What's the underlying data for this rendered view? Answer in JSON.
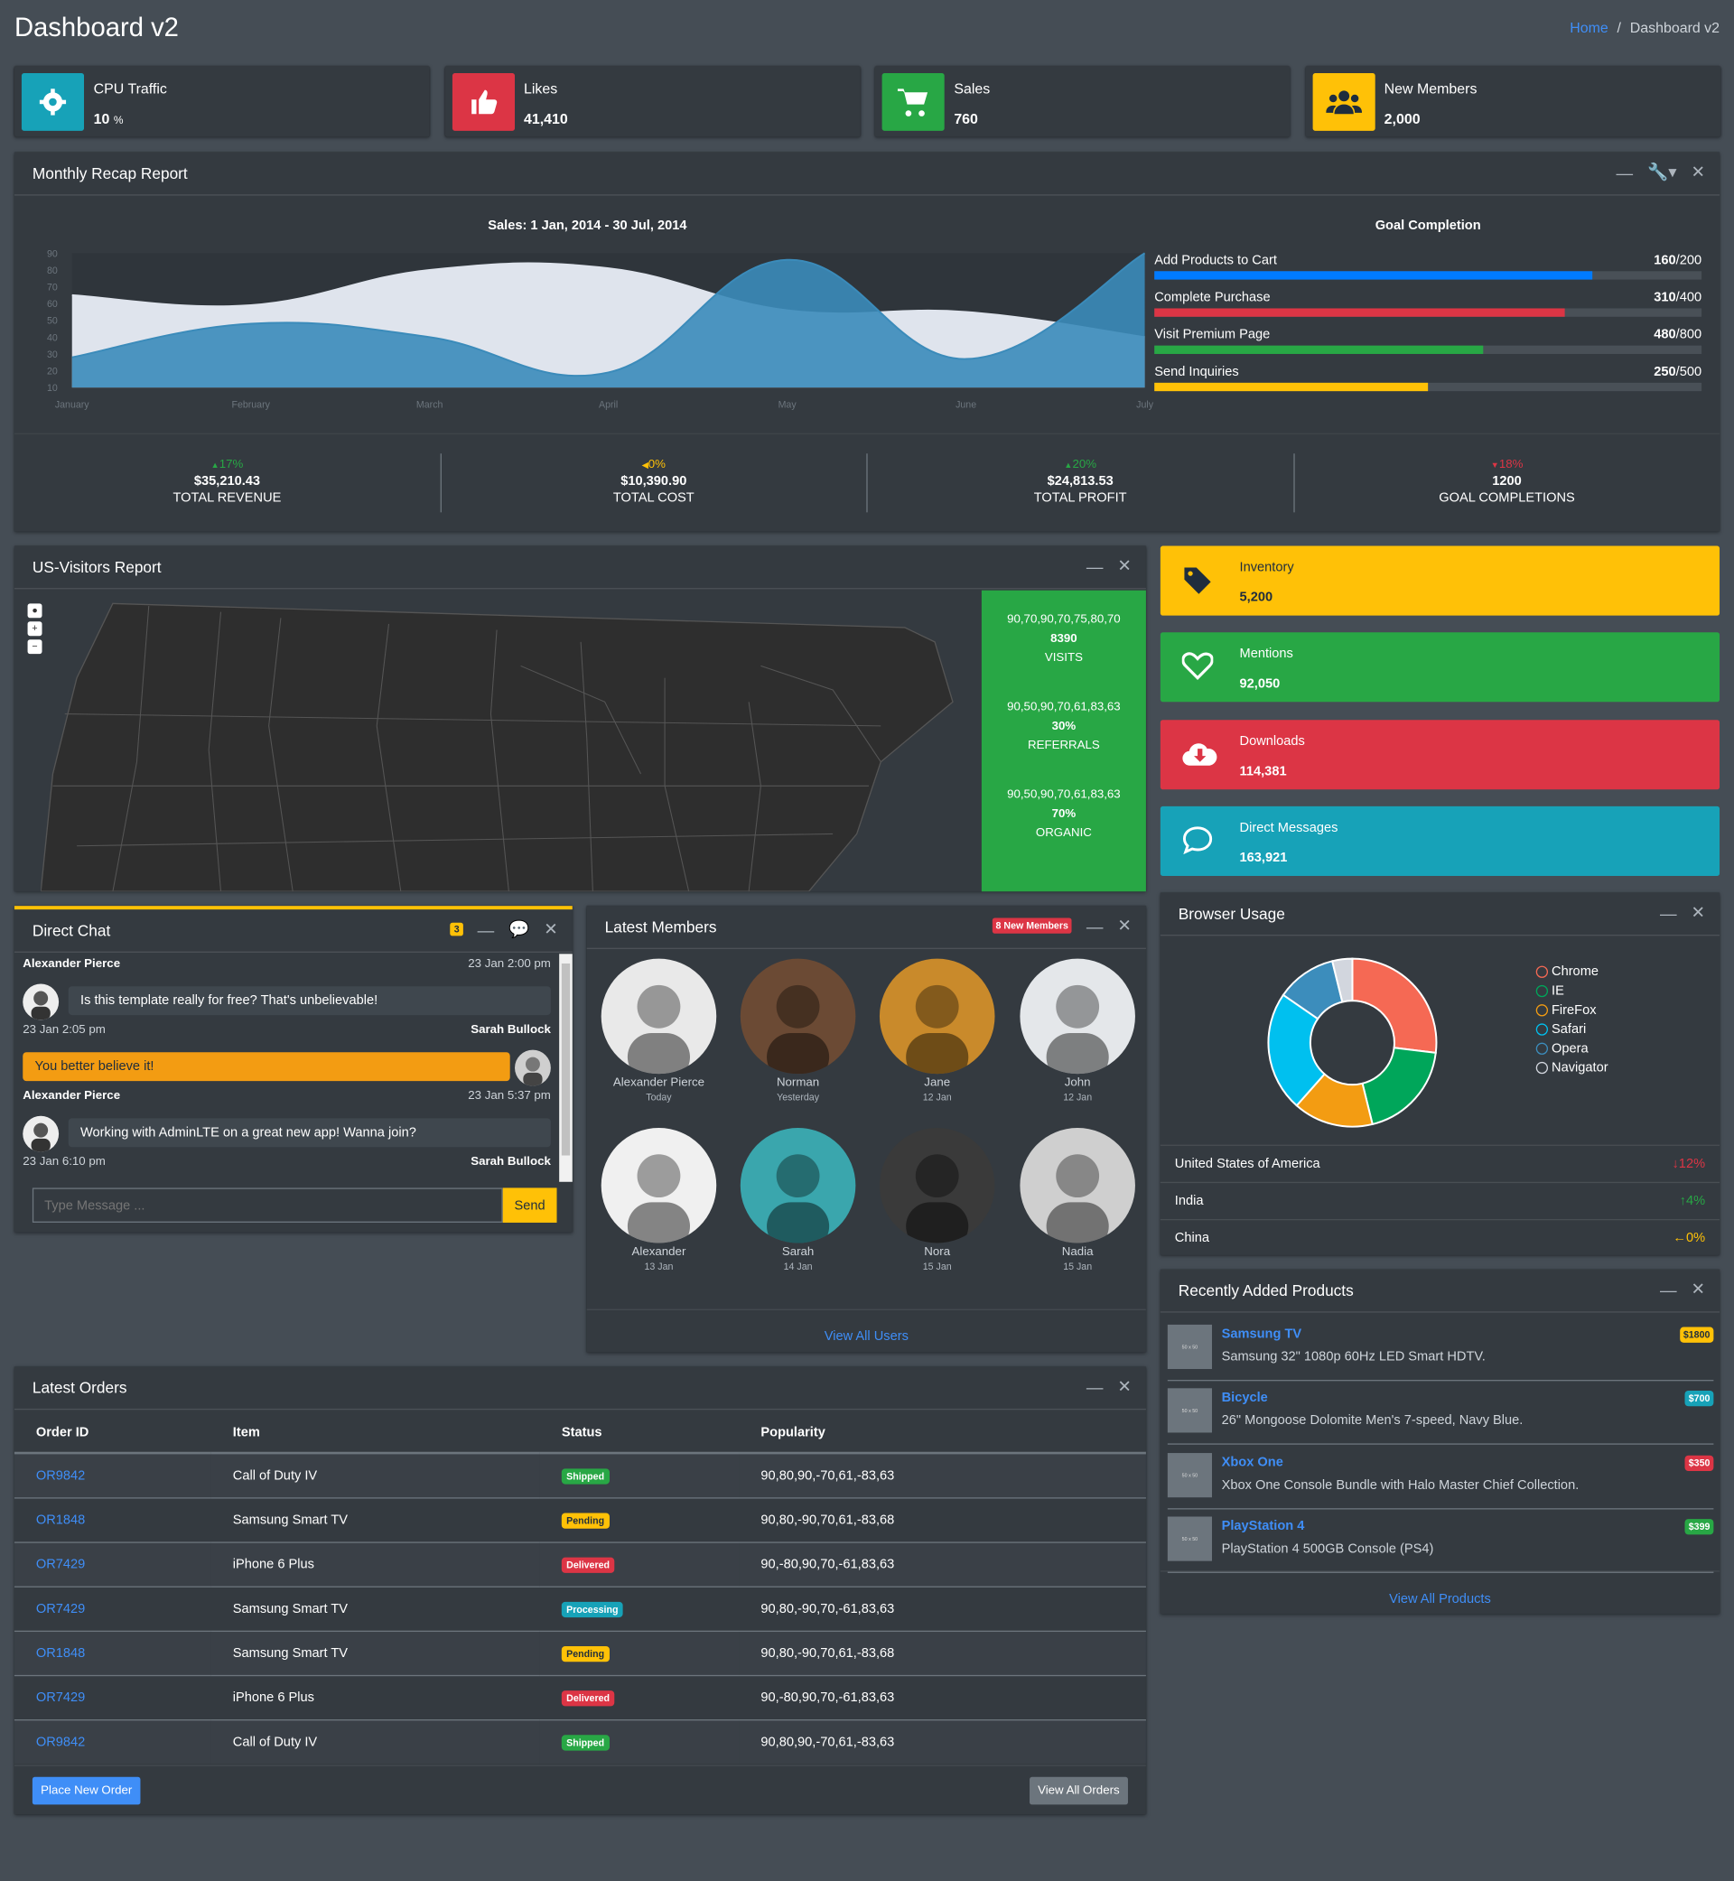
{
  "header": {
    "title": "Dashboard v2",
    "breadcrumb_home": "Home",
    "breadcrumb_sep": "/",
    "breadcrumb_current": "Dashboard v2"
  },
  "info_boxes": [
    {
      "label": "CPU Traffic",
      "value": "10",
      "unit": "%",
      "color": "#17a2b8",
      "icon": "gear-icon"
    },
    {
      "label": "Likes",
      "value": "41,410",
      "color": "#dc3545",
      "icon": "thumbs-up-icon"
    },
    {
      "label": "Sales",
      "value": "760",
      "color": "#28a745",
      "icon": "cart-icon"
    },
    {
      "label": "New Members",
      "value": "2,000",
      "color": "#ffc107",
      "icon": "users-icon"
    }
  ],
  "recap": {
    "title": "Monthly Recap Report",
    "chart_title": "Sales: 1 Jan, 2014 - 30 Jul, 2014",
    "goal_title": "Goal Completion",
    "goals": [
      {
        "label": "Add Products to Cart",
        "value": "160",
        "total": "/200",
        "fraction": 0.8,
        "color": "#007bff"
      },
      {
        "label": "Complete Purchase",
        "value": "310",
        "total": "/400",
        "fraction": 0.75,
        "color": "#dc3545"
      },
      {
        "label": "Visit Premium Page",
        "value": "480",
        "total": "/800",
        "fraction": 0.6,
        "color": "#28a745"
      },
      {
        "label": "Send Inquiries",
        "value": "250",
        "total": "/500",
        "fraction": 0.5,
        "color": "#ffc107"
      }
    ],
    "footer": [
      {
        "pct": "17%",
        "dir": "up",
        "color": "#28a745",
        "arrow": "▲",
        "amount": "$35,210.43",
        "label": "TOTAL REVENUE"
      },
      {
        "pct": "0%",
        "dir": "left",
        "color": "#ffc107",
        "arrow": "◀",
        "amount": "$10,390.90",
        "label": "TOTAL COST"
      },
      {
        "pct": "20%",
        "dir": "up",
        "color": "#28a745",
        "arrow": "▲",
        "amount": "$24,813.53",
        "label": "TOTAL PROFIT"
      },
      {
        "pct": "18%",
        "dir": "down",
        "color": "#dc3545",
        "arrow": "▼",
        "amount": "1200",
        "label": "GOAL COMPLETIONS"
      }
    ]
  },
  "chart_data": {
    "type": "area",
    "categories": [
      "January",
      "February",
      "March",
      "April",
      "May",
      "June",
      "July"
    ],
    "ylim": [
      10,
      90
    ],
    "yticks": [
      10,
      20,
      30,
      40,
      50,
      60,
      70,
      80,
      90
    ],
    "series": [
      {
        "values": [
          65,
          59,
          80,
          81,
          56,
          55,
          40
        ],
        "color": "#dfe4ed"
      },
      {
        "values": [
          28,
          48,
          40,
          19,
          86,
          27,
          90
        ],
        "color": "#3b8bba"
      }
    ]
  },
  "visitors": {
    "title": "US-Visitors Report",
    "stats": [
      {
        "spark": "90,70,90,70,75,80,70",
        "value": "8390",
        "label": "VISITS"
      },
      {
        "spark": "90,50,90,70,61,83,63",
        "value": "30%",
        "label": "REFERRALS"
      },
      {
        "spark": "90,50,90,70,61,83,63",
        "value": "70%",
        "label": "ORGANIC"
      }
    ]
  },
  "small_boxes": [
    {
      "label": "Inventory",
      "value": "5,200",
      "color": "#ffc107",
      "text": "#1f2d3d",
      "icon": "tag-icon"
    },
    {
      "label": "Mentions",
      "value": "92,050",
      "color": "#28a745",
      "text": "#fff",
      "icon": "heart-icon"
    },
    {
      "label": "Downloads",
      "value": "114,381",
      "color": "#dc3545",
      "text": "#fff",
      "icon": "cloud-download-icon"
    },
    {
      "label": "Direct Messages",
      "value": "163,921",
      "color": "#17a2b8",
      "text": "#fff",
      "icon": "comment-icon"
    }
  ],
  "chat": {
    "title": "Direct Chat",
    "badge": "3",
    "messages": [
      {
        "name": "Alexander Pierce",
        "time": "23 Jan 2:00 pm",
        "text": "Is this template really for free? That's unbelievable!",
        "side": "left"
      },
      {
        "name": "Sarah Bullock",
        "time": "23 Jan 2:05 pm",
        "text": "You better believe it!",
        "side": "right"
      },
      {
        "name": "Alexander Pierce",
        "time": "23 Jan 5:37 pm",
        "text": "Working with AdminLTE on a great new app! Wanna join?",
        "side": "left"
      },
      {
        "name": "Sarah Bullock",
        "time": "23 Jan 6:10 pm",
        "text": "",
        "side": "right"
      }
    ],
    "placeholder": "Type Message ...",
    "send": "Send"
  },
  "members": {
    "title": "Latest Members",
    "badge": "8 New Members",
    "view_all": "View All Users",
    "list": [
      {
        "name": "Alexander Pierce",
        "date": "Today",
        "color": "#e9e9e9"
      },
      {
        "name": "Norman",
        "date": "Yesterday",
        "color": "#6b4a34"
      },
      {
        "name": "Jane",
        "date": "12 Jan",
        "color": "#c98a2b"
      },
      {
        "name": "John",
        "date": "12 Jan",
        "color": "#e4e7ea"
      },
      {
        "name": "Alexander",
        "date": "13 Jan",
        "color": "#f0f0f0"
      },
      {
        "name": "Sarah",
        "date": "14 Jan",
        "color": "#3aa6ad"
      },
      {
        "name": "Nora",
        "date": "15 Jan",
        "color": "#3a3a3a"
      },
      {
        "name": "Nadia",
        "date": "15 Jan",
        "color": "#cfcfcf"
      }
    ]
  },
  "browser": {
    "title": "Browser Usage",
    "legend": [
      {
        "name": "Chrome",
        "color": "#f56954",
        "value": 700
      },
      {
        "name": "IE",
        "color": "#00a65a",
        "value": 500
      },
      {
        "name": "FireFox",
        "color": "#f39c12",
        "value": 400
      },
      {
        "name": "Safari",
        "color": "#00c0ef",
        "value": 600
      },
      {
        "name": "Opera",
        "color": "#3c8dbc",
        "value": 300
      },
      {
        "name": "Navigator",
        "color": "#d2d6de",
        "value": 100
      }
    ],
    "countries": [
      {
        "name": "United States of America",
        "value": "12%",
        "arrow": "↓",
        "color": "#dc3545"
      },
      {
        "name": "India",
        "value": "4%",
        "arrow": "↑",
        "color": "#28a745"
      },
      {
        "name": "China",
        "value": "0%",
        "arrow": "←",
        "color": "#ffc107"
      }
    ]
  },
  "orders": {
    "title": "Latest Orders",
    "headers": [
      "Order ID",
      "Item",
      "Status",
      "Popularity"
    ],
    "rows": [
      {
        "id": "OR9842",
        "item": "Call of Duty IV",
        "status": "Shipped",
        "color": "#28a745",
        "pop": "90,80,90,-70,61,-83,63"
      },
      {
        "id": "OR1848",
        "item": "Samsung Smart TV",
        "status": "Pending",
        "color": "#ffc107",
        "pop": "90,80,-90,70,61,-83,68"
      },
      {
        "id": "OR7429",
        "item": "iPhone 6 Plus",
        "status": "Delivered",
        "color": "#dc3545",
        "pop": "90,-80,90,70,-61,83,63"
      },
      {
        "id": "OR7429",
        "item": "Samsung Smart TV",
        "status": "Processing",
        "color": "#17a2b8",
        "pop": "90,80,-90,70,-61,83,63"
      },
      {
        "id": "OR1848",
        "item": "Samsung Smart TV",
        "status": "Pending",
        "color": "#ffc107",
        "pop": "90,80,-90,70,61,-83,68"
      },
      {
        "id": "OR7429",
        "item": "iPhone 6 Plus",
        "status": "Delivered",
        "color": "#dc3545",
        "pop": "90,-80,90,70,-61,83,63"
      },
      {
        "id": "OR9842",
        "item": "Call of Duty IV",
        "status": "Shipped",
        "color": "#28a745",
        "pop": "90,80,90,-70,61,-83,63"
      }
    ],
    "place": "Place New Order",
    "view": "View All Orders"
  },
  "products": {
    "title": "Recently Added Products",
    "view_all": "View All Products",
    "img_label": "50 x 50",
    "list": [
      {
        "name": "Samsung TV",
        "desc": "Samsung 32\" 1080p 60Hz LED Smart HDTV.",
        "price": "$1800",
        "color": "#ffc107",
        "text": "#1f2d3d"
      },
      {
        "name": "Bicycle",
        "desc": "26\" Mongoose Dolomite Men's 7-speed, Navy Blue.",
        "price": "$700",
        "color": "#17a2b8",
        "text": "#fff"
      },
      {
        "name": "Xbox One",
        "desc": "Xbox One Console Bundle with Halo Master Chief Collection.",
        "price": "$350",
        "color": "#dc3545",
        "text": "#fff"
      },
      {
        "name": "PlayStation 4",
        "desc": "PlayStation 4 500GB Console (PS4)",
        "price": "$399",
        "color": "#28a745",
        "text": "#fff"
      }
    ]
  }
}
